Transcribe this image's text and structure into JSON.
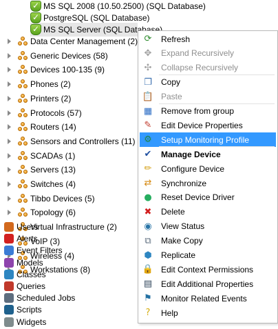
{
  "tree": {
    "databases": [
      {
        "label": "MS SQL 2008 (10.50.2500) (SQL Database)"
      },
      {
        "label": "PostgreSQL (SQL Database)"
      },
      {
        "label": "MS SQL Server (SQL Database)"
      }
    ],
    "groups": [
      {
        "label": "Data Center Management (2)"
      },
      {
        "label": "Generic Devices (58)"
      },
      {
        "label": "Devices 100-135 (9)"
      },
      {
        "label": "Phones (2)"
      },
      {
        "label": "Printers (2)"
      },
      {
        "label": "Protocols (57)"
      },
      {
        "label": "Routers (14)"
      },
      {
        "label": "Sensors and Controllers (11)"
      },
      {
        "label": "SCADAs (1)"
      },
      {
        "label": "Servers (13)"
      },
      {
        "label": "Switches (4)"
      },
      {
        "label": "Tibbo Devices (5)"
      },
      {
        "label": "Topology (6)"
      },
      {
        "label": "Virtual Infrastructure (2)"
      },
      {
        "label": "VoIP (3)"
      },
      {
        "label": "Wireless (4)"
      },
      {
        "label": "Workstations (8)"
      }
    ],
    "root_items": [
      {
        "label": "Users",
        "icon": "users-icon",
        "color": "#d2691e"
      },
      {
        "label": "Alerts",
        "icon": "alerts-icon",
        "color": "#d22020"
      },
      {
        "label": "Event Filters",
        "icon": "event-filters-icon",
        "color": "#3a7bd5"
      },
      {
        "label": "Models",
        "icon": "models-icon",
        "color": "#8e44ad"
      },
      {
        "label": "Classes",
        "icon": "classes-icon",
        "color": "#2e86c1"
      },
      {
        "label": "Queries",
        "icon": "queries-icon",
        "color": "#c0392b"
      },
      {
        "label": "Scheduled Jobs",
        "icon": "scheduled-jobs-icon",
        "color": "#5d6d7e"
      },
      {
        "label": "Scripts",
        "icon": "scripts-icon",
        "color": "#1f618d"
      },
      {
        "label": "Widgets",
        "icon": "widgets-icon",
        "color": "#7f8c8d"
      }
    ]
  },
  "context_menu": {
    "items": [
      {
        "label": "Refresh",
        "icon": "refresh-icon",
        "glyph": "⟳",
        "color": "#2e8b2e",
        "state": "normal"
      },
      {
        "label": "Expand Recursively",
        "icon": "expand-recursively-icon",
        "glyph": "✥",
        "color": "#a0a0a0",
        "state": "disabled"
      },
      {
        "label": "Collapse Recursively",
        "icon": "collapse-recursively-icon",
        "glyph": "✣",
        "color": "#a0a0a0",
        "state": "disabled"
      },
      {
        "label": "Copy",
        "icon": "copy-icon",
        "glyph": "❐",
        "color": "#3a6fb0",
        "state": "normal"
      },
      {
        "label": "Paste",
        "icon": "paste-icon",
        "glyph": "📋",
        "color": "#a0a0a0",
        "state": "disabled"
      },
      {
        "label": "Remove from group",
        "icon": "remove-from-group-icon",
        "glyph": "▦",
        "color": "#2b6cc4",
        "state": "normal"
      },
      {
        "label": "Edit Device Properties",
        "icon": "edit-device-properties-icon",
        "glyph": "✎",
        "color": "#c0392b",
        "state": "normal"
      },
      {
        "label": "Setup Monitoring Profile",
        "icon": "setup-monitoring-profile-icon",
        "glyph": "⚙",
        "color": "#1e8449",
        "state": "highlight"
      },
      {
        "label": "Manage Device",
        "icon": "manage-device-icon",
        "glyph": "✔",
        "color": "#1f4fa0",
        "state": "bold"
      },
      {
        "label": "Configure Device",
        "icon": "configure-device-icon",
        "glyph": "✏",
        "color": "#d4a017",
        "state": "normal"
      },
      {
        "label": "Synchronize",
        "icon": "synchronize-icon",
        "glyph": "⇄",
        "color": "#d68910",
        "state": "normal"
      },
      {
        "label": "Reset Device Driver",
        "icon": "reset-device-driver-icon",
        "glyph": "●",
        "color": "#27ae60",
        "state": "normal"
      },
      {
        "label": "Delete",
        "icon": "delete-icon",
        "glyph": "✖",
        "color": "#d21f1f",
        "state": "normal"
      },
      {
        "label": "View Status",
        "icon": "view-status-icon",
        "glyph": "◉",
        "color": "#2874a6",
        "state": "normal"
      },
      {
        "label": "Make Copy",
        "icon": "make-copy-icon",
        "glyph": "⧉",
        "color": "#5d6d7e",
        "state": "normal"
      },
      {
        "label": "Replicate",
        "icon": "replicate-icon",
        "glyph": "⬢",
        "color": "#2e86c1",
        "state": "normal"
      },
      {
        "label": "Edit Context Permissions",
        "icon": "edit-context-permissions-icon",
        "glyph": "🔒",
        "color": "#d4ac0d",
        "state": "normal"
      },
      {
        "label": "Edit Additional Properties",
        "icon": "edit-additional-properties-icon",
        "glyph": "▤",
        "color": "#34495e",
        "state": "normal"
      },
      {
        "label": "Monitor Related Events",
        "icon": "monitor-related-events-icon",
        "glyph": "⚑",
        "color": "#2471a3",
        "state": "normal"
      },
      {
        "label": "Help",
        "icon": "help-icon",
        "glyph": "?",
        "color": "#d4ac0d",
        "state": "normal"
      }
    ],
    "highlight_color": "#3399ff"
  }
}
